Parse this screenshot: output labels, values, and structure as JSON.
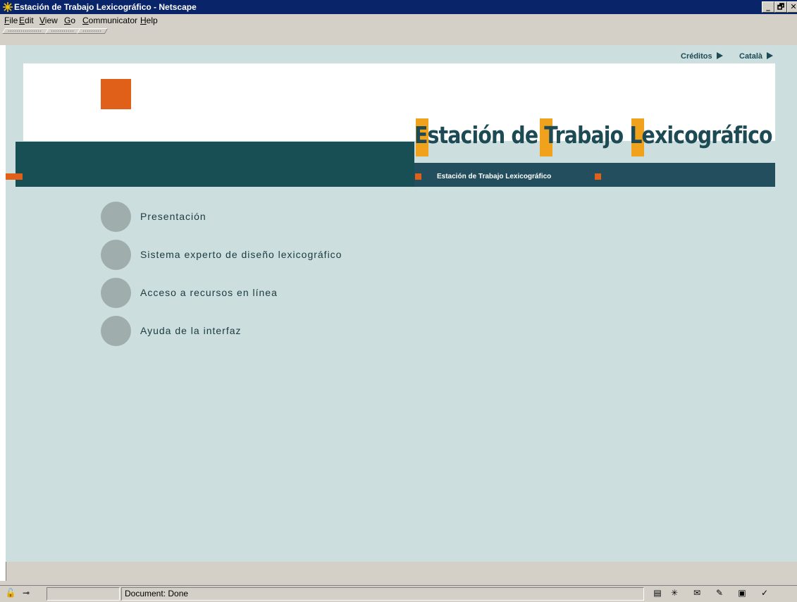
{
  "window": {
    "title": "Estación de Trabajo Lexicográfico - Netscape",
    "controls": {
      "minimize": "_",
      "restore": "🗗",
      "close": "✕"
    }
  },
  "menubar": {
    "items": [
      {
        "label": "File",
        "accel": "F",
        "rest": "ile"
      },
      {
        "label": "Edit",
        "accel": "E",
        "rest": "dit"
      },
      {
        "label": "View",
        "accel": "V",
        "rest": "iew"
      },
      {
        "label": "Go",
        "accel": "G",
        "rest": "o"
      },
      {
        "label": "Communicator",
        "accel": "C",
        "rest": "ommunicator"
      },
      {
        "label": "Help",
        "accel": "H",
        "rest": "elp"
      }
    ]
  },
  "page": {
    "top_links": {
      "credits": "Créditos",
      "language": "Català"
    },
    "logo_text": "Estación de Trabajo Lexicográfico",
    "subtitle": "Estación de Trabajo Lexicográfico",
    "nav": [
      {
        "label": "Presentación"
      },
      {
        "label": "Sistema experto de diseño lexicográfico"
      },
      {
        "label": "Acceso a recursos en línea"
      },
      {
        "label": "Ayuda de la interfaz"
      }
    ],
    "colors": {
      "background": "#cddede",
      "accent_orange": "#e0601a",
      "band_teal": "#174f55",
      "logo_yellow": "#f1a21c",
      "circle_gray": "#9fadad"
    }
  },
  "statusbar": {
    "text": "Document: Done",
    "icons": [
      "security-icon",
      "connection-icon",
      "document-icon",
      "navigator-icon",
      "mail-icon",
      "discussion-icon",
      "composer-icon",
      "dial-icon"
    ]
  }
}
